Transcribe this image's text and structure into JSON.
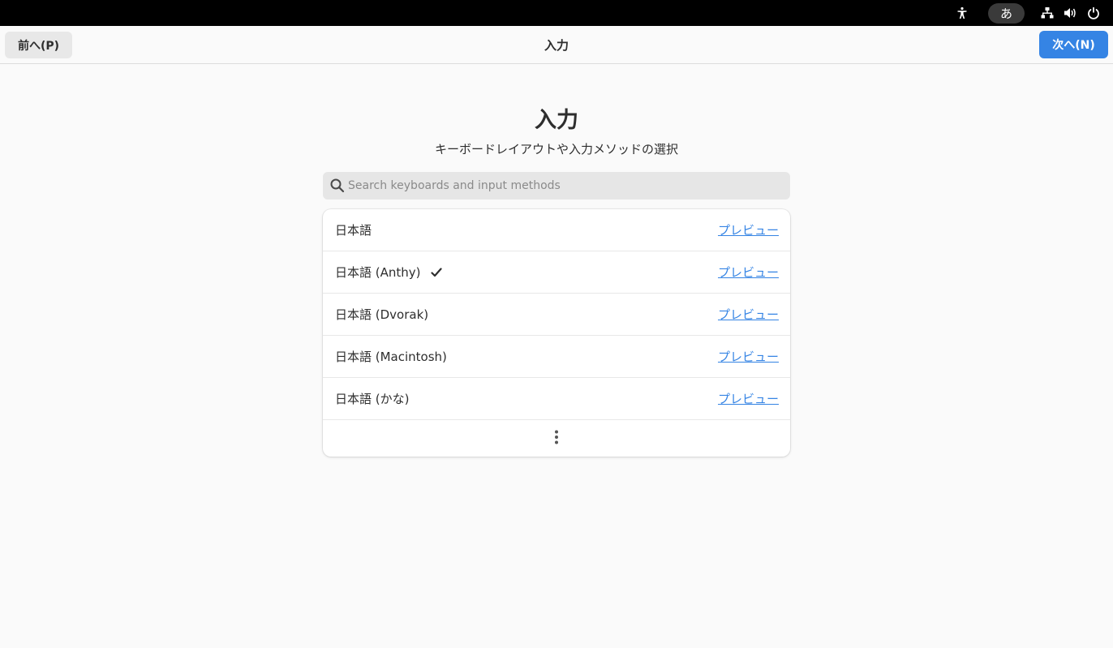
{
  "topbar": {
    "accessibility_icon": "accessibility-icon",
    "input_method_label": "あ",
    "network_icon": "network-wired-icon",
    "volume_icon": "volume-icon",
    "power_icon": "power-icon"
  },
  "header": {
    "prev_label": "前へ(P)",
    "title": "入力",
    "next_label": "次へ(N)"
  },
  "main": {
    "title": "入力",
    "subtitle": "キーボードレイアウトや入力メソッドの選択",
    "search": {
      "placeholder": "Search keyboards and input methods",
      "value": ""
    },
    "items": [
      {
        "name": "日本語",
        "preview": "プレビュー",
        "selected": false
      },
      {
        "name": "日本語 (Anthy)",
        "preview": "プレビュー",
        "selected": true
      },
      {
        "name": "日本語 (Dvorak)",
        "preview": "プレビュー",
        "selected": false
      },
      {
        "name": "日本語 (Macintosh)",
        "preview": "プレビュー",
        "selected": false
      },
      {
        "name": "日本語 (かな)",
        "preview": "プレビュー",
        "selected": false
      }
    ],
    "more_icon": "view-more-icon"
  },
  "colors": {
    "accent": "#3584e4",
    "topbar": "#000000",
    "background": "#fafafa"
  }
}
